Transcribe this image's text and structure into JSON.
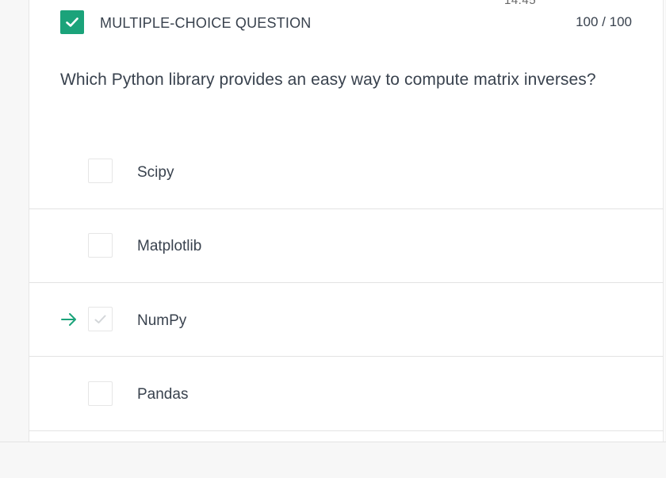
{
  "header": {
    "timer_fragment": "14:45",
    "question_type": "MULTIPLE-CHOICE QUESTION",
    "score": "100 / 100"
  },
  "question": {
    "text": "Which Python library provides an easy way to compute matrix inverses?"
  },
  "options": [
    {
      "label": "Scipy",
      "selected": false
    },
    {
      "label": "Matplotlib",
      "selected": false
    },
    {
      "label": "NumPy",
      "selected": true,
      "indicator": "arrow-right-icon"
    },
    {
      "label": "Pandas",
      "selected": false
    }
  ],
  "colors": {
    "accent": "#1ba37a",
    "text": "#39424e",
    "border": "#e3e3e3",
    "background": "#f7f7f7"
  }
}
